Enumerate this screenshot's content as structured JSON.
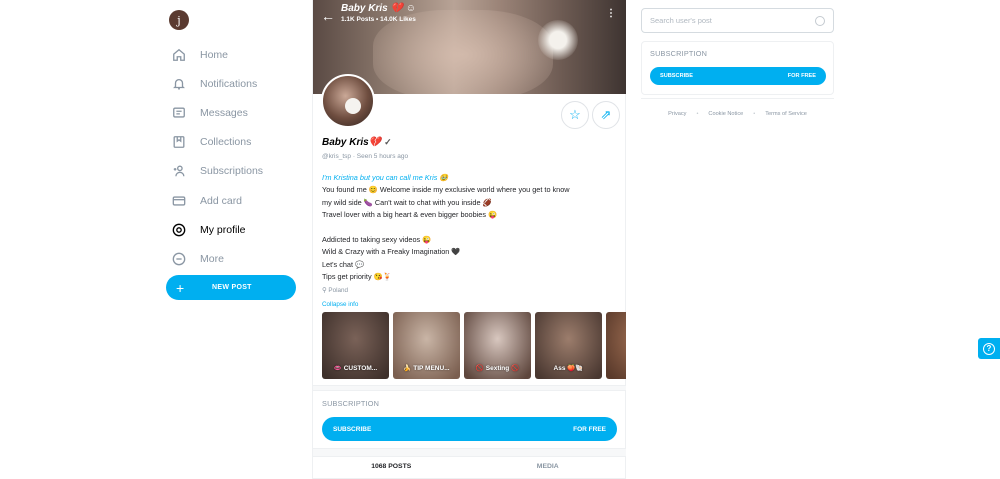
{
  "user": {
    "avatar_letter": "j"
  },
  "nav": {
    "items": [
      {
        "label": "Home",
        "icon": "home-icon"
      },
      {
        "label": "Notifications",
        "icon": "bell-icon"
      },
      {
        "label": "Messages",
        "icon": "message-icon"
      },
      {
        "label": "Collections",
        "icon": "bookmark-icon"
      },
      {
        "label": "Subscriptions",
        "icon": "subscriptions-icon"
      },
      {
        "label": "Add card",
        "icon": "card-icon"
      },
      {
        "label": "My profile",
        "icon": "profile-icon"
      },
      {
        "label": "More",
        "icon": "more-icon"
      }
    ],
    "active": "My profile",
    "new_post_label": "NEW POST"
  },
  "cover": {
    "name": "Baby Kris 💔 ☺",
    "stats": "1.1K Posts  •  14.0K Likes"
  },
  "profile": {
    "name": "Baby Kris💔",
    "verified_icon": "✓",
    "handle": "@kris_tsp",
    "seen": "Seen 5 hours ago",
    "bio_highlight": "I'm Kristina but you can call me Kris 🥹",
    "bio_lines": [
      "You found me 😊 Welcome inside my exclusive world where you get to know",
      "my wild side 🍆 Can't wait to chat with you inside 🏈",
      "Travel lover with a big heart & even bigger boobies 😜",
      "",
      "Addicted to taking sexy videos 😜",
      "Wild & Crazy with a Freaky Imagination 🖤",
      "Let's chat 💬",
      "Tips get priority 😘🍹"
    ],
    "location": "Poland",
    "collapse_label": "Collapse info"
  },
  "highlights": [
    {
      "label": "👄 CUSTOM...",
      "colors": [
        "#7a6258",
        "#3e302b"
      ]
    },
    {
      "label": "🍌 TIP MENU...",
      "colors": [
        "#c9b5a6",
        "#7b5f50"
      ]
    },
    {
      "label": "🚫 Sexting 🚫",
      "colors": [
        "#d8c7bf",
        "#5e463d"
      ]
    },
    {
      "label": "Ass 🍑🐚",
      "colors": [
        "#9c7d6c",
        "#4a3831"
      ]
    },
    {
      "label": "🔥🔥",
      "colors": [
        "#a17054",
        "#5a3a2b"
      ]
    }
  ],
  "subscription": {
    "heading": "SUBSCRIPTION",
    "button_label": "SUBSCRIBE",
    "price": "FOR FREE"
  },
  "tabs": [
    {
      "label": "1068 POSTS",
      "active": true
    },
    {
      "label": "MEDIA",
      "active": false
    }
  ],
  "right": {
    "search_placeholder": "Search user's post",
    "footer_links": [
      "Privacy",
      "Cookie Notice",
      "Terms of Service"
    ]
  },
  "colors": {
    "accent": "#00aff0",
    "muted": "#8a96a3"
  }
}
